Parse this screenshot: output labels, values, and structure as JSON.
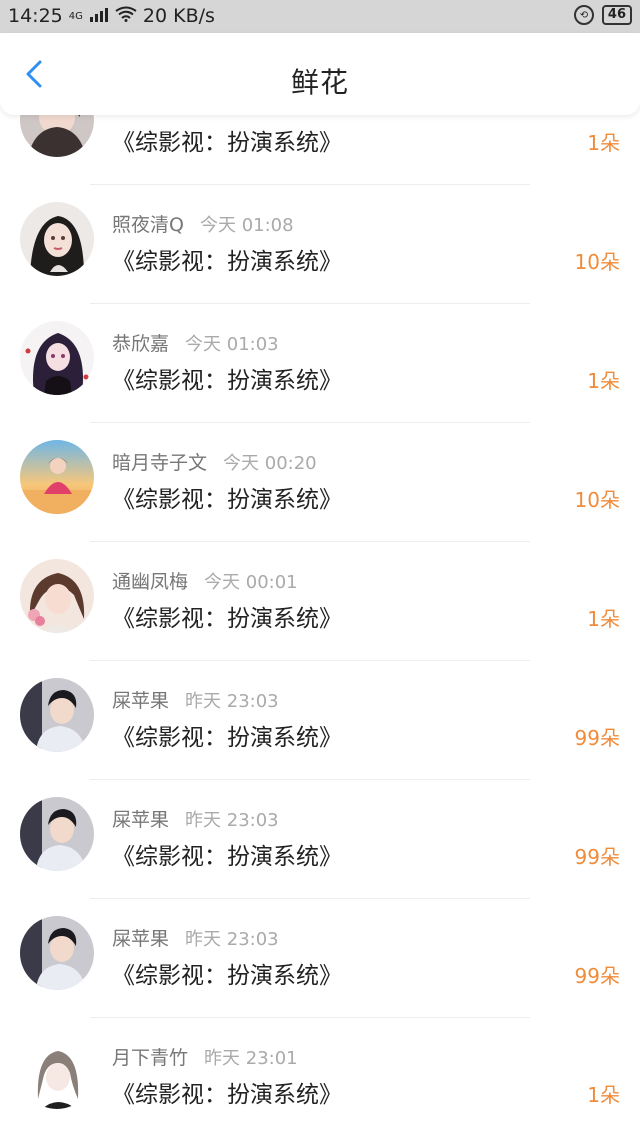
{
  "status_bar": {
    "time": "14:25",
    "network": "4G",
    "speed": "20 KB/s",
    "battery": "46"
  },
  "header": {
    "title": "鲜花"
  },
  "colors": {
    "accent": "#2f8ff5",
    "amount": "#f08b3a"
  },
  "items": [
    {
      "user": "",
      "time": "",
      "title": "《综影视：扮演系统》",
      "amount": "1朵"
    },
    {
      "user": "照夜清Q",
      "time": "今天 01:08",
      "title": "《综影视：扮演系统》",
      "amount": "10朵"
    },
    {
      "user": "恭欣嘉",
      "time": "今天 01:03",
      "title": "《综影视：扮演系统》",
      "amount": "1朵"
    },
    {
      "user": "暗月寺子文",
      "time": "今天 00:20",
      "title": "《综影视：扮演系统》",
      "amount": "10朵"
    },
    {
      "user": "通幽凤梅",
      "time": "今天 00:01",
      "title": "《综影视：扮演系统》",
      "amount": "1朵"
    },
    {
      "user": "屎苹果",
      "time": "昨天 23:03",
      "title": "《综影视：扮演系统》",
      "amount": "99朵"
    },
    {
      "user": "屎苹果",
      "time": "昨天 23:03",
      "title": "《综影视：扮演系统》",
      "amount": "99朵"
    },
    {
      "user": "屎苹果",
      "time": "昨天 23:03",
      "title": "《综影视：扮演系统》",
      "amount": "99朵"
    },
    {
      "user": "月下青竹",
      "time": "昨天 23:01",
      "title": "《综影视：扮演系统》",
      "amount": "1朵"
    }
  ]
}
